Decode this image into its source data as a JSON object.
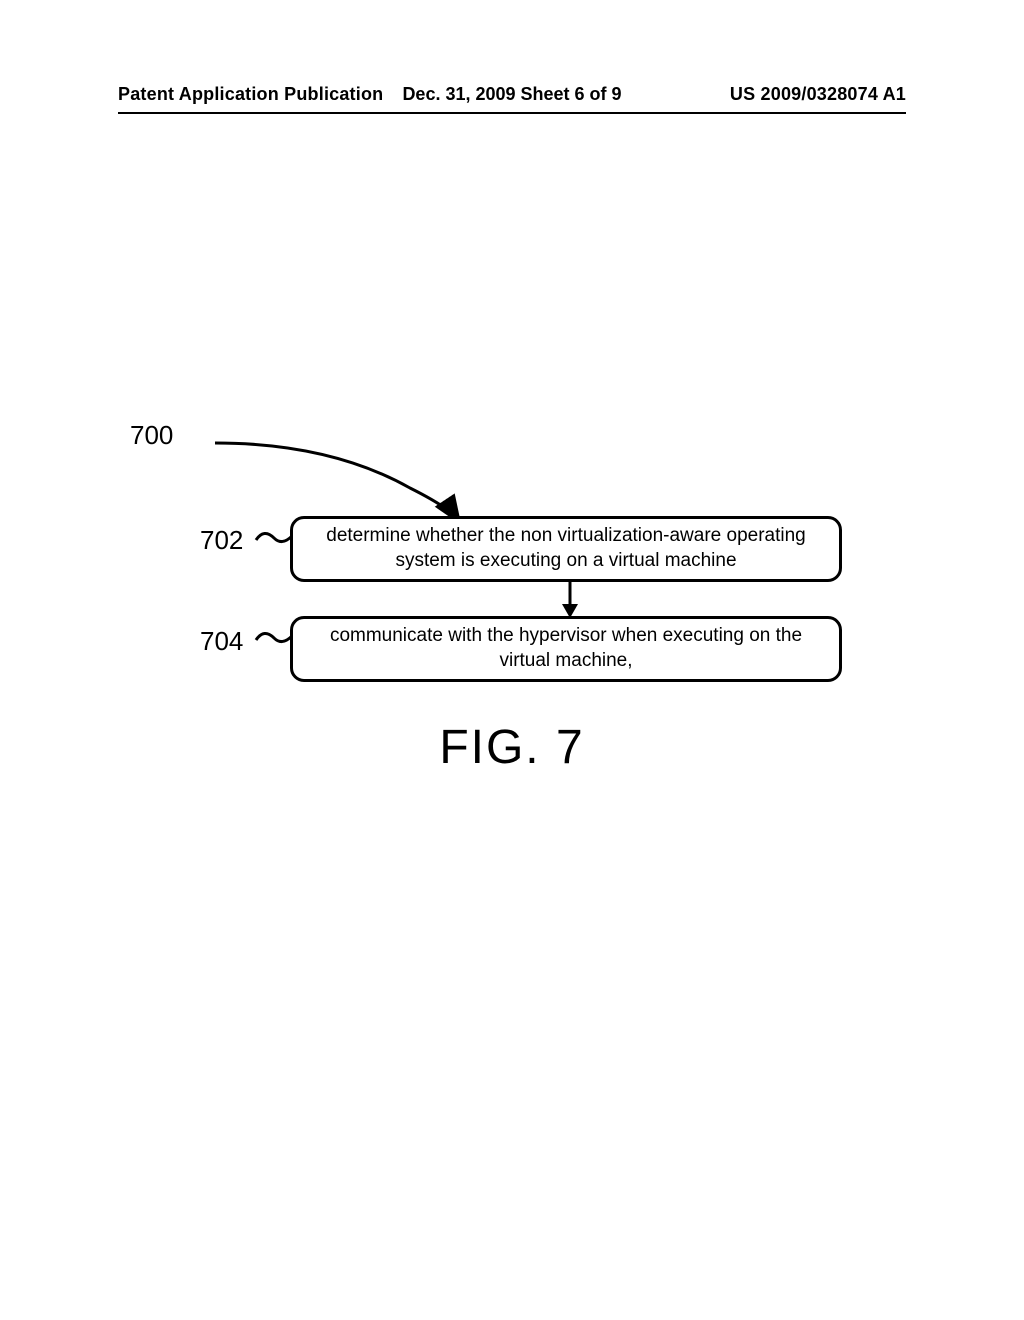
{
  "header": {
    "left": "Patent Application Publication",
    "center": "Dec. 31, 2009  Sheet 6 of 9",
    "right": "US 2009/0328074 A1"
  },
  "flow": {
    "ref_main": "700",
    "step1": {
      "ref": "702",
      "text": "determine whether the non virtualization-aware operating system is executing on a virtual machine"
    },
    "step2": {
      "ref": "704",
      "text": "communicate with the hypervisor when executing on the virtual machine,"
    }
  },
  "figure_label": "FIG. 7"
}
